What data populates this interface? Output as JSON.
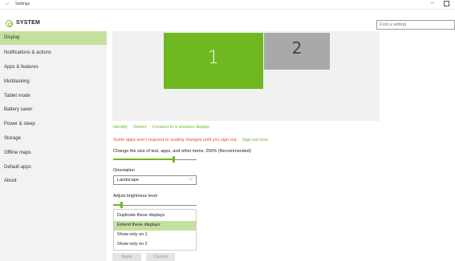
{
  "window": {
    "title": "Settings",
    "back_glyph": "←",
    "minimize_glyph": "–"
  },
  "header": {
    "title": "SYSTEM",
    "icon": "gear-icon"
  },
  "search": {
    "placeholder": "Find a setting"
  },
  "sidebar": {
    "items": [
      {
        "label": "Display",
        "active": true
      },
      {
        "label": "Notifications & actions"
      },
      {
        "label": "Apps & features"
      },
      {
        "label": "Multitasking"
      },
      {
        "label": "Tablet mode"
      },
      {
        "label": "Battery saver"
      },
      {
        "label": "Power & sleep"
      },
      {
        "label": "Storage"
      },
      {
        "label": "Offline maps"
      },
      {
        "label": "Default apps"
      },
      {
        "label": "About"
      }
    ]
  },
  "monitors": {
    "primary": "1",
    "secondary": "2",
    "primary_color": "#6fb822",
    "secondary_color": "#a9a9a9"
  },
  "links": {
    "identify": "Identify",
    "detect": "Detect",
    "wireless": "Connect to a wireless display"
  },
  "warning": {
    "text": "Some apps won't respond to scaling changes until you sign out.",
    "sign_out": "Sign out now"
  },
  "scaling": {
    "label": "Change the size of text, apps, and other items: 250% (Recommended)",
    "level": 0.72
  },
  "orientation": {
    "label": "Orientation",
    "value": "Landscape",
    "chevron": "⌵"
  },
  "brightness": {
    "label": "Adjust brightness level",
    "level": 0.1
  },
  "multiple_displays": {
    "options": [
      "Duplicate these displays",
      "Extend these displays",
      "Show only on 1",
      "Show only on 2"
    ],
    "selected": "Extend these displays"
  },
  "buttons": {
    "apply": "Apply",
    "cancel": "Cancel"
  },
  "colors": {
    "accent": "#6fb822",
    "warning": "#e24c2b",
    "sidebar_active": "#c5e1a0"
  }
}
